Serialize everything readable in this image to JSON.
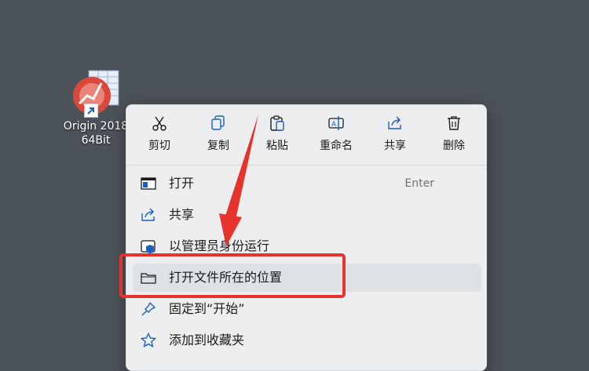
{
  "desktop": {
    "shortcut": {
      "line1": "Origin 2018",
      "line2": "64Bit",
      "icon": "origin-app-icon"
    }
  },
  "context_menu": {
    "quick_actions": [
      {
        "label": "剪切",
        "icon": "scissors-icon"
      },
      {
        "label": "复制",
        "icon": "copy-icon"
      },
      {
        "label": "粘贴",
        "icon": "paste-icon"
      },
      {
        "label": "重命名",
        "icon": "rename-icon"
      },
      {
        "label": "共享",
        "icon": "share-icon"
      },
      {
        "label": "删除",
        "icon": "trash-icon"
      }
    ],
    "items": [
      {
        "label": "打开",
        "shortcut": "Enter",
        "icon": "open-window-icon"
      },
      {
        "label": "共享",
        "icon": "share-icon"
      },
      {
        "label": "以管理员身份运行",
        "icon": "shield-icon"
      },
      {
        "label": "打开文件所在的位置",
        "icon": "folder-icon",
        "hovered": true
      },
      {
        "label": "固定到“开始”",
        "icon": "pin-icon"
      },
      {
        "label": "添加到收藏夹",
        "icon": "star-icon"
      }
    ]
  },
  "annotation": {
    "box_color": "#e8322c",
    "arrow_color": "#e8322c"
  }
}
